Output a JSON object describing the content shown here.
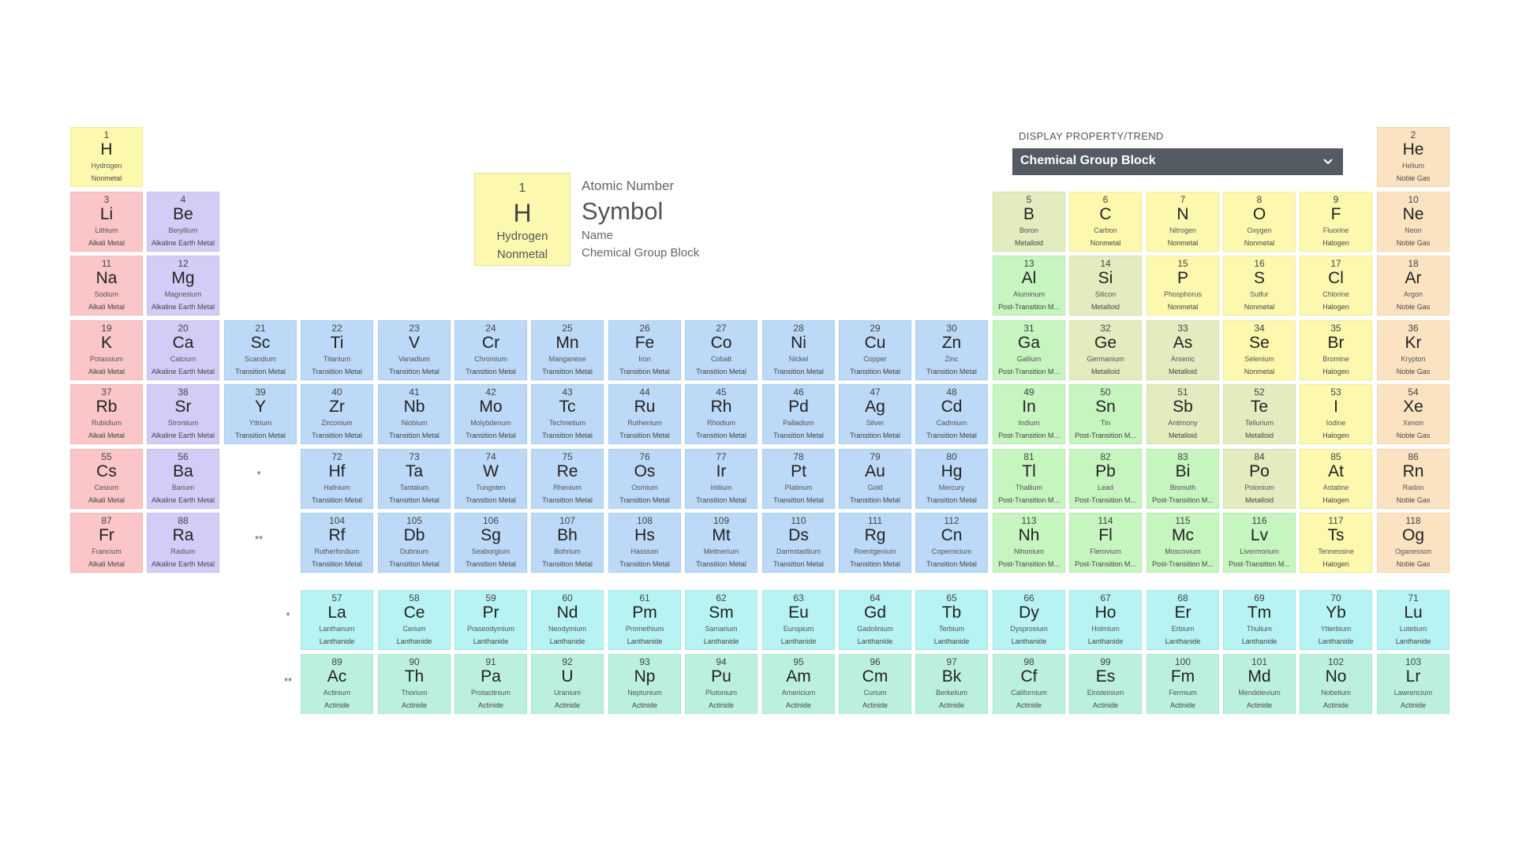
{
  "legend": {
    "atomic_number": "1",
    "symbol": "H",
    "name": "Hydrogen",
    "group": "Nonmetal",
    "labels": {
      "atomic_number": "Atomic Number",
      "symbol": "Symbol",
      "name": "Name",
      "group": "Chemical Group Block"
    }
  },
  "property_selector": {
    "label": "DISPLAY PROPERTY/TREND",
    "selected": "Chemical Group Block",
    "icon": "chevron-down-icon"
  },
  "markers": {
    "lanthanide": "*",
    "actinide": "**"
  },
  "group_colors": {
    "Alkali Metal": "#fac6c8",
    "Alkaline Earth Metal": "#d3ccf7",
    "Transition Metal": "#bcd9f7",
    "Post-Transition Metal": "#c6f5c0",
    "Metalloid": "#e2ecbe",
    "Nonmetal": "#fcf8ae",
    "Halogen": "#fcf8ae",
    "Noble Gas": "#fbe3c2",
    "Lanthanide": "#b7f3f3",
    "Actinide": "#bbf1dc"
  },
  "elements": [
    {
      "n": "1",
      "s": "H",
      "name": "Hydrogen",
      "g": "Nonmetal",
      "col": 1,
      "row": 1
    },
    {
      "n": "2",
      "s": "He",
      "name": "Helium",
      "g": "Noble Gas",
      "col": 18,
      "row": 1
    },
    {
      "n": "3",
      "s": "Li",
      "name": "Lithium",
      "g": "Alkali Metal",
      "col": 1,
      "row": 2
    },
    {
      "n": "4",
      "s": "Be",
      "name": "Beryllium",
      "g": "Alkaline Earth Metal",
      "col": 2,
      "row": 2
    },
    {
      "n": "5",
      "s": "B",
      "name": "Boron",
      "g": "Metalloid",
      "col": 13,
      "row": 2
    },
    {
      "n": "6",
      "s": "C",
      "name": "Carbon",
      "g": "Nonmetal",
      "col": 14,
      "row": 2
    },
    {
      "n": "7",
      "s": "N",
      "name": "Nitrogen",
      "g": "Nonmetal",
      "col": 15,
      "row": 2
    },
    {
      "n": "8",
      "s": "O",
      "name": "Oxygen",
      "g": "Nonmetal",
      "col": 16,
      "row": 2
    },
    {
      "n": "9",
      "s": "F",
      "name": "Fluorine",
      "g": "Halogen",
      "col": 17,
      "row": 2
    },
    {
      "n": "10",
      "s": "Ne",
      "name": "Neon",
      "g": "Noble Gas",
      "col": 18,
      "row": 2
    },
    {
      "n": "11",
      "s": "Na",
      "name": "Sodium",
      "g": "Alkali Metal",
      "col": 1,
      "row": 3
    },
    {
      "n": "12",
      "s": "Mg",
      "name": "Magnesium",
      "g": "Alkaline Earth Metal",
      "col": 2,
      "row": 3
    },
    {
      "n": "13",
      "s": "Al",
      "name": "Aluminum",
      "g": "Post-Transition M...",
      "gc": "Post-Transition Metal",
      "col": 13,
      "row": 3
    },
    {
      "n": "14",
      "s": "Si",
      "name": "Silicon",
      "g": "Metalloid",
      "col": 14,
      "row": 3
    },
    {
      "n": "15",
      "s": "P",
      "name": "Phosphorus",
      "g": "Nonmetal",
      "col": 15,
      "row": 3
    },
    {
      "n": "16",
      "s": "S",
      "name": "Sulfur",
      "g": "Nonmetal",
      "col": 16,
      "row": 3
    },
    {
      "n": "17",
      "s": "Cl",
      "name": "Chlorine",
      "g": "Halogen",
      "col": 17,
      "row": 3
    },
    {
      "n": "18",
      "s": "Ar",
      "name": "Argon",
      "g": "Noble Gas",
      "col": 18,
      "row": 3
    },
    {
      "n": "19",
      "s": "K",
      "name": "Potassium",
      "g": "Alkali Metal",
      "col": 1,
      "row": 4
    },
    {
      "n": "20",
      "s": "Ca",
      "name": "Calcium",
      "g": "Alkaline Earth Metal",
      "col": 2,
      "row": 4
    },
    {
      "n": "21",
      "s": "Sc",
      "name": "Scandium",
      "g": "Transition Metal",
      "col": 3,
      "row": 4
    },
    {
      "n": "22",
      "s": "Ti",
      "name": "Titanium",
      "g": "Transition Metal",
      "col": 4,
      "row": 4
    },
    {
      "n": "23",
      "s": "V",
      "name": "Vanadium",
      "g": "Transition Metal",
      "col": 5,
      "row": 4
    },
    {
      "n": "24",
      "s": "Cr",
      "name": "Chromium",
      "g": "Transition Metal",
      "col": 6,
      "row": 4
    },
    {
      "n": "25",
      "s": "Mn",
      "name": "Manganese",
      "g": "Transition Metal",
      "col": 7,
      "row": 4
    },
    {
      "n": "26",
      "s": "Fe",
      "name": "Iron",
      "g": "Transition Metal",
      "col": 8,
      "row": 4
    },
    {
      "n": "27",
      "s": "Co",
      "name": "Cobalt",
      "g": "Transition Metal",
      "col": 9,
      "row": 4
    },
    {
      "n": "28",
      "s": "Ni",
      "name": "Nickel",
      "g": "Transition Metal",
      "col": 10,
      "row": 4
    },
    {
      "n": "29",
      "s": "Cu",
      "name": "Copper",
      "g": "Transition Metal",
      "col": 11,
      "row": 4
    },
    {
      "n": "30",
      "s": "Zn",
      "name": "Zinc",
      "g": "Transition Metal",
      "col": 12,
      "row": 4
    },
    {
      "n": "31",
      "s": "Ga",
      "name": "Gallium",
      "g": "Post-Transition M...",
      "gc": "Post-Transition Metal",
      "col": 13,
      "row": 4
    },
    {
      "n": "32",
      "s": "Ge",
      "name": "Germanium",
      "g": "Metalloid",
      "col": 14,
      "row": 4
    },
    {
      "n": "33",
      "s": "As",
      "name": "Arsenic",
      "g": "Metalloid",
      "col": 15,
      "row": 4
    },
    {
      "n": "34",
      "s": "Se",
      "name": "Selenium",
      "g": "Nonmetal",
      "col": 16,
      "row": 4
    },
    {
      "n": "35",
      "s": "Br",
      "name": "Bromine",
      "g": "Halogen",
      "col": 17,
      "row": 4
    },
    {
      "n": "36",
      "s": "Kr",
      "name": "Krypton",
      "g": "Noble Gas",
      "col": 18,
      "row": 4
    },
    {
      "n": "37",
      "s": "Rb",
      "name": "Rubidium",
      "g": "Alkali Metal",
      "col": 1,
      "row": 5
    },
    {
      "n": "38",
      "s": "Sr",
      "name": "Strontium",
      "g": "Alkaline Earth Metal",
      "col": 2,
      "row": 5
    },
    {
      "n": "39",
      "s": "Y",
      "name": "Yttrium",
      "g": "Transition Metal",
      "col": 3,
      "row": 5
    },
    {
      "n": "40",
      "s": "Zr",
      "name": "Zirconium",
      "g": "Transition Metal",
      "col": 4,
      "row": 5
    },
    {
      "n": "41",
      "s": "Nb",
      "name": "Niobium",
      "g": "Transition Metal",
      "col": 5,
      "row": 5
    },
    {
      "n": "42",
      "s": "Mo",
      "name": "Molybdenum",
      "g": "Transition Metal",
      "col": 6,
      "row": 5
    },
    {
      "n": "43",
      "s": "Tc",
      "name": "Technetium",
      "g": "Transition Metal",
      "col": 7,
      "row": 5
    },
    {
      "n": "44",
      "s": "Ru",
      "name": "Ruthenium",
      "g": "Transition Metal",
      "col": 8,
      "row": 5
    },
    {
      "n": "45",
      "s": "Rh",
      "name": "Rhodium",
      "g": "Transition Metal",
      "col": 9,
      "row": 5
    },
    {
      "n": "46",
      "s": "Pd",
      "name": "Palladium",
      "g": "Transition Metal",
      "col": 10,
      "row": 5
    },
    {
      "n": "47",
      "s": "Ag",
      "name": "Silver",
      "g": "Transition Metal",
      "col": 11,
      "row": 5
    },
    {
      "n": "48",
      "s": "Cd",
      "name": "Cadmium",
      "g": "Transition Metal",
      "col": 12,
      "row": 5
    },
    {
      "n": "49",
      "s": "In",
      "name": "Indium",
      "g": "Post-Transition M...",
      "gc": "Post-Transition Metal",
      "col": 13,
      "row": 5
    },
    {
      "n": "50",
      "s": "Sn",
      "name": "Tin",
      "g": "Post-Transition M...",
      "gc": "Post-Transition Metal",
      "col": 14,
      "row": 5
    },
    {
      "n": "51",
      "s": "Sb",
      "name": "Antimony",
      "g": "Metalloid",
      "col": 15,
      "row": 5
    },
    {
      "n": "52",
      "s": "Te",
      "name": "Tellurium",
      "g": "Metalloid",
      "col": 16,
      "row": 5
    },
    {
      "n": "53",
      "s": "I",
      "name": "Iodine",
      "g": "Halogen",
      "col": 17,
      "row": 5
    },
    {
      "n": "54",
      "s": "Xe",
      "name": "Xenon",
      "g": "Noble Gas",
      "col": 18,
      "row": 5
    },
    {
      "n": "55",
      "s": "Cs",
      "name": "Cesium",
      "g": "Alkali Metal",
      "col": 1,
      "row": 6
    },
    {
      "n": "56",
      "s": "Ba",
      "name": "Barium",
      "g": "Alkaline Earth Metal",
      "col": 2,
      "row": 6
    },
    {
      "n": "72",
      "s": "Hf",
      "name": "Hafnium",
      "g": "Transition Metal",
      "col": 4,
      "row": 6
    },
    {
      "n": "73",
      "s": "Ta",
      "name": "Tantalum",
      "g": "Transition Metal",
      "col": 5,
      "row": 6
    },
    {
      "n": "74",
      "s": "W",
      "name": "Tungsten",
      "g": "Transition Metal",
      "col": 6,
      "row": 6
    },
    {
      "n": "75",
      "s": "Re",
      "name": "Rhenium",
      "g": "Transition Metal",
      "col": 7,
      "row": 6
    },
    {
      "n": "76",
      "s": "Os",
      "name": "Osmium",
      "g": "Transition Metal",
      "col": 8,
      "row": 6
    },
    {
      "n": "77",
      "s": "Ir",
      "name": "Iridium",
      "g": "Transition Metal",
      "col": 9,
      "row": 6
    },
    {
      "n": "78",
      "s": "Pt",
      "name": "Platinum",
      "g": "Transition Metal",
      "col": 10,
      "row": 6
    },
    {
      "n": "79",
      "s": "Au",
      "name": "Gold",
      "g": "Transition Metal",
      "col": 11,
      "row": 6
    },
    {
      "n": "80",
      "s": "Hg",
      "name": "Mercury",
      "g": "Transition Metal",
      "col": 12,
      "row": 6
    },
    {
      "n": "81",
      "s": "Tl",
      "name": "Thallium",
      "g": "Post-Transition M...",
      "gc": "Post-Transition Metal",
      "col": 13,
      "row": 6
    },
    {
      "n": "82",
      "s": "Pb",
      "name": "Lead",
      "g": "Post-Transition M...",
      "gc": "Post-Transition Metal",
      "col": 14,
      "row": 6
    },
    {
      "n": "83",
      "s": "Bi",
      "name": "Bismuth",
      "g": "Post-Transition M...",
      "gc": "Post-Transition Metal",
      "col": 15,
      "row": 6
    },
    {
      "n": "84",
      "s": "Po",
      "name": "Polonium",
      "g": "Metalloid",
      "col": 16,
      "row": 6
    },
    {
      "n": "85",
      "s": "At",
      "name": "Astatine",
      "g": "Halogen",
      "col": 17,
      "row": 6
    },
    {
      "n": "86",
      "s": "Rn",
      "name": "Radon",
      "g": "Noble Gas",
      "col": 18,
      "row": 6
    },
    {
      "n": "87",
      "s": "Fr",
      "name": "Francium",
      "g": "Alkali Metal",
      "col": 1,
      "row": 7
    },
    {
      "n": "88",
      "s": "Ra",
      "name": "Radium",
      "g": "Alkaline Earth Metal",
      "col": 2,
      "row": 7
    },
    {
      "n": "104",
      "s": "Rf",
      "name": "Rutherfordium",
      "g": "Transition Metal",
      "col": 4,
      "row": 7
    },
    {
      "n": "105",
      "s": "Db",
      "name": "Dubnium",
      "g": "Transition Metal",
      "col": 5,
      "row": 7
    },
    {
      "n": "106",
      "s": "Sg",
      "name": "Seaborgium",
      "g": "Transition Metal",
      "col": 6,
      "row": 7
    },
    {
      "n": "107",
      "s": "Bh",
      "name": "Bohrium",
      "g": "Transition Metal",
      "col": 7,
      "row": 7
    },
    {
      "n": "108",
      "s": "Hs",
      "name": "Hassium",
      "g": "Transition Metal",
      "col": 8,
      "row": 7
    },
    {
      "n": "109",
      "s": "Mt",
      "name": "Meitnerium",
      "g": "Transition Metal",
      "col": 9,
      "row": 7
    },
    {
      "n": "110",
      "s": "Ds",
      "name": "Darmstadtium",
      "g": "Transition Metal",
      "col": 10,
      "row": 7
    },
    {
      "n": "111",
      "s": "Rg",
      "name": "Roentgenium",
      "g": "Transition Metal",
      "col": 11,
      "row": 7
    },
    {
      "n": "112",
      "s": "Cn",
      "name": "Copernicium",
      "g": "Transition Metal",
      "col": 12,
      "row": 7
    },
    {
      "n": "113",
      "s": "Nh",
      "name": "Nihonium",
      "g": "Post-Transition M...",
      "gc": "Post-Transition Metal",
      "col": 13,
      "row": 7
    },
    {
      "n": "114",
      "s": "Fl",
      "name": "Flerovium",
      "g": "Post-Transition M...",
      "gc": "Post-Transition Metal",
      "col": 14,
      "row": 7
    },
    {
      "n": "115",
      "s": "Mc",
      "name": "Moscovium",
      "g": "Post-Transition M...",
      "gc": "Post-Transition Metal",
      "col": 15,
      "row": 7
    },
    {
      "n": "116",
      "s": "Lv",
      "name": "Livermorium",
      "g": "Post-Transition M...",
      "gc": "Post-Transition Metal",
      "col": 16,
      "row": 7
    },
    {
      "n": "117",
      "s": "Ts",
      "name": "Tennessine",
      "g": "Halogen",
      "col": 17,
      "row": 7
    },
    {
      "n": "118",
      "s": "Og",
      "name": "Oganesson",
      "g": "Noble Gas",
      "col": 18,
      "row": 7
    },
    {
      "n": "57",
      "s": "La",
      "name": "Lanthanum",
      "g": "Lanthanide",
      "col": 4,
      "row": 8
    },
    {
      "n": "58",
      "s": "Ce",
      "name": "Cerium",
      "g": "Lanthanide",
      "col": 5,
      "row": 8
    },
    {
      "n": "59",
      "s": "Pr",
      "name": "Praseodymium",
      "g": "Lanthanide",
      "col": 6,
      "row": 8
    },
    {
      "n": "60",
      "s": "Nd",
      "name": "Neodymium",
      "g": "Lanthanide",
      "col": 7,
      "row": 8
    },
    {
      "n": "61",
      "s": "Pm",
      "name": "Promethium",
      "g": "Lanthanide",
      "col": 8,
      "row": 8
    },
    {
      "n": "62",
      "s": "Sm",
      "name": "Samarium",
      "g": "Lanthanide",
      "col": 9,
      "row": 8
    },
    {
      "n": "63",
      "s": "Eu",
      "name": "Europium",
      "g": "Lanthanide",
      "col": 10,
      "row": 8
    },
    {
      "n": "64",
      "s": "Gd",
      "name": "Gadolinium",
      "g": "Lanthanide",
      "col": 11,
      "row": 8
    },
    {
      "n": "65",
      "s": "Tb",
      "name": "Terbium",
      "g": "Lanthanide",
      "col": 12,
      "row": 8
    },
    {
      "n": "66",
      "s": "Dy",
      "name": "Dysprosium",
      "g": "Lanthanide",
      "col": 13,
      "row": 8
    },
    {
      "n": "67",
      "s": "Ho",
      "name": "Holmium",
      "g": "Lanthanide",
      "col": 14,
      "row": 8
    },
    {
      "n": "68",
      "s": "Er",
      "name": "Erbium",
      "g": "Lanthanide",
      "col": 15,
      "row": 8
    },
    {
      "n": "69",
      "s": "Tm",
      "name": "Thulium",
      "g": "Lanthanide",
      "col": 16,
      "row": 8
    },
    {
      "n": "70",
      "s": "Yb",
      "name": "Ytterbium",
      "g": "Lanthanide",
      "col": 17,
      "row": 8
    },
    {
      "n": "71",
      "s": "Lu",
      "name": "Lutetium",
      "g": "Lanthanide",
      "col": 18,
      "row": 8
    },
    {
      "n": "89",
      "s": "Ac",
      "name": "Actinium",
      "g": "Actinide",
      "col": 4,
      "row": 9
    },
    {
      "n": "90",
      "s": "Th",
      "name": "Thorium",
      "g": "Actinide",
      "col": 5,
      "row": 9
    },
    {
      "n": "91",
      "s": "Pa",
      "name": "Protactinium",
      "g": "Actinide",
      "col": 6,
      "row": 9
    },
    {
      "n": "92",
      "s": "U",
      "name": "Uranium",
      "g": "Actinide",
      "col": 7,
      "row": 9
    },
    {
      "n": "93",
      "s": "Np",
      "name": "Neptunium",
      "g": "Actinide",
      "col": 8,
      "row": 9
    },
    {
      "n": "94",
      "s": "Pu",
      "name": "Plutonium",
      "g": "Actinide",
      "col": 9,
      "row": 9
    },
    {
      "n": "95",
      "s": "Am",
      "name": "Americium",
      "g": "Actinide",
      "col": 10,
      "row": 9
    },
    {
      "n": "96",
      "s": "Cm",
      "name": "Curium",
      "g": "Actinide",
      "col": 11,
      "row": 9
    },
    {
      "n": "97",
      "s": "Bk",
      "name": "Berkelium",
      "g": "Actinide",
      "col": 12,
      "row": 9
    },
    {
      "n": "98",
      "s": "Cf",
      "name": "Californium",
      "g": "Actinide",
      "col": 13,
      "row": 9
    },
    {
      "n": "99",
      "s": "Es",
      "name": "Einsteinium",
      "g": "Actinide",
      "col": 14,
      "row": 9
    },
    {
      "n": "100",
      "s": "Fm",
      "name": "Fermium",
      "g": "Actinide",
      "col": 15,
      "row": 9
    },
    {
      "n": "101",
      "s": "Md",
      "name": "Mendelevium",
      "g": "Actinide",
      "col": 16,
      "row": 9
    },
    {
      "n": "102",
      "s": "No",
      "name": "Nobelium",
      "g": "Actinide",
      "col": 17,
      "row": 9
    },
    {
      "n": "103",
      "s": "Lr",
      "name": "Lawrencium",
      "g": "Actinide",
      "col": 18,
      "row": 9
    }
  ]
}
